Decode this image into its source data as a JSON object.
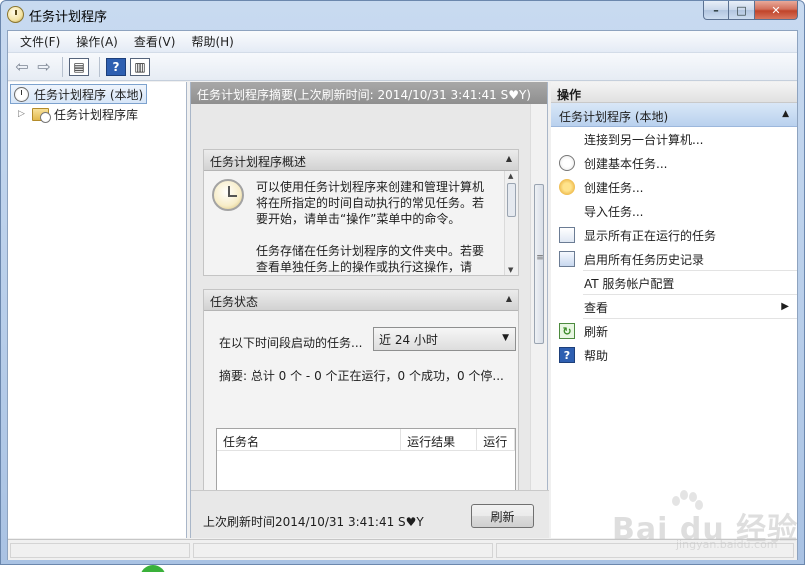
{
  "window": {
    "title": "任务计划程序"
  },
  "menu": [
    "文件(F)",
    "操作(A)",
    "查看(V)",
    "帮助(H)"
  ],
  "tree": {
    "root": "任务计划程序 (本地)",
    "child": "任务计划程序库"
  },
  "center": {
    "header": "任务计划程序摘要(上次刷新时间: 2014/10/31 3:41:41 S♥Y)",
    "overview": {
      "title": "任务计划程序概述",
      "para1": "可以使用任务计划程序来创建和管理计算机将在所指定的时间自动执行的常见任务。若要开始，请单击“操作”菜单中的命令。",
      "para2": "任务存储在任务计划程序的文件夹中。若要查看单独任务上的操作或执行这操作，请"
    },
    "status": {
      "title": "任务状态",
      "period_label": "在以下时间段启动的任务...",
      "period_value": "近 24 小时",
      "summary": "摘要: 总计 0 个 - 0 个正在运行，0 个成功，0 个停...",
      "columns": [
        "任务名",
        "运行结果",
        "运行"
      ]
    },
    "footer": {
      "last_refresh": "上次刷新时间2014/10/31 3:41:41 S♥Y",
      "refresh_button": "刷新"
    }
  },
  "actions": {
    "header": "操作",
    "group": "任务计划程序 (本地)",
    "items": [
      {
        "label": "连接到另一台计算机...",
        "icon": "none"
      },
      {
        "label": "创建基本任务...",
        "icon": "create-basic-task-icon"
      },
      {
        "label": "创建任务...",
        "icon": "create-task-icon"
      },
      {
        "label": "导入任务...",
        "icon": "none"
      },
      {
        "label": "显示所有正在运行的任务",
        "icon": "running-tasks-icon"
      },
      {
        "label": "启用所有任务历史记录",
        "icon": "history-icon"
      },
      {
        "label": "AT 服务帐户配置",
        "icon": "none"
      },
      {
        "label": "查看",
        "icon": "none",
        "submenu": true
      },
      {
        "label": "刷新",
        "icon": "refresh-icon"
      },
      {
        "label": "帮助",
        "icon": "help-icon"
      }
    ]
  },
  "watermark": {
    "main": "Bai du 经验",
    "sub": "jingyan.baidu.com"
  }
}
